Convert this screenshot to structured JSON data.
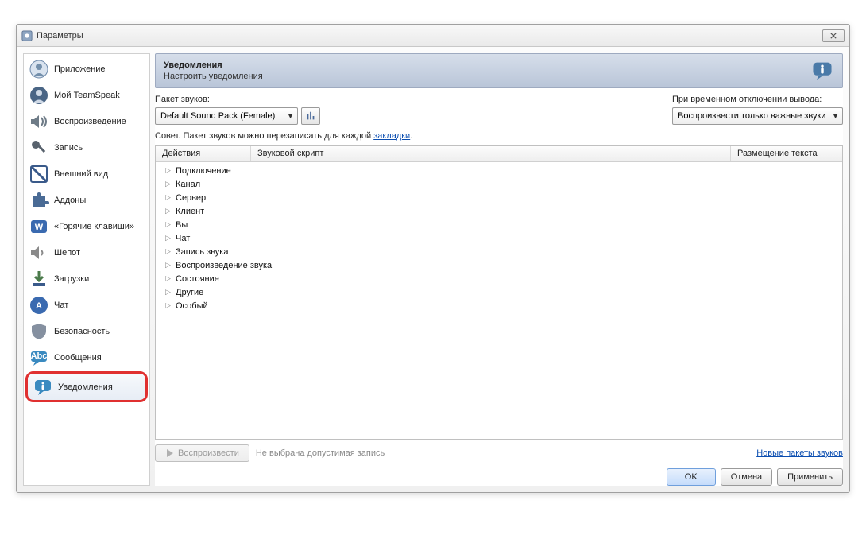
{
  "window": {
    "title": "Параметры"
  },
  "sidebar": {
    "items": [
      {
        "label": "Приложение"
      },
      {
        "label": "Мой TeamSpeak"
      },
      {
        "label": "Воспроизведение"
      },
      {
        "label": "Запись"
      },
      {
        "label": "Внешний вид"
      },
      {
        "label": "Аддоны"
      },
      {
        "label": "«Горячие клавиши»"
      },
      {
        "label": "Шепот"
      },
      {
        "label": "Загрузки"
      },
      {
        "label": "Чат"
      },
      {
        "label": "Безопасность"
      },
      {
        "label": "Сообщения"
      },
      {
        "label": "Уведомления"
      }
    ]
  },
  "header": {
    "title": "Уведомления",
    "subtitle": "Настроить уведомления"
  },
  "soundpack": {
    "label": "Пакет звуков:",
    "selected": "Default Sound Pack (Female)"
  },
  "tempdisable": {
    "label": "При временном отключении вывода:",
    "selected": "Воспроизвести только важные звуки"
  },
  "tip": {
    "prefix": "Совет. Пакет звуков можно перезаписать для каждой ",
    "link": "закладки",
    "suffix": "."
  },
  "table": {
    "columns": [
      "Действия",
      "Звуковой скрипт",
      "Размещение текста"
    ]
  },
  "tree": [
    "Подключение",
    "Канал",
    "Сервер",
    "Клиент",
    "Вы",
    "Чат",
    "Запись звука",
    "Воспроизведение звука",
    "Состояние",
    "Другие",
    "Особый"
  ],
  "footer": {
    "play": "Воспроизвести",
    "status": "Не выбрана допустимая запись",
    "newpacks": "Новые пакеты звуков"
  },
  "buttons": {
    "ok": "OK",
    "cancel": "Отмена",
    "apply": "Применить"
  }
}
